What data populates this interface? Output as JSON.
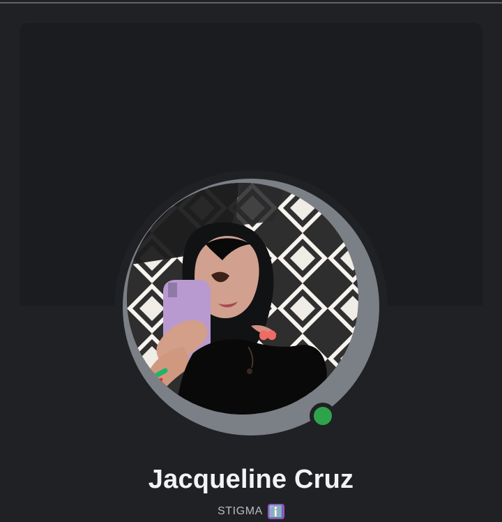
{
  "profile": {
    "name": "Jacqueline Cruz",
    "tagline": "STIGMA",
    "status": "online"
  },
  "icons": {
    "status": "online-status-icon",
    "tagline_badge": "info-icon",
    "tagline_badge_text": "ℹ️"
  },
  "colors": {
    "background": "#202124",
    "banner": "#1b1c1f",
    "status": "#2fa34a",
    "badge": "#9b4fd1"
  }
}
